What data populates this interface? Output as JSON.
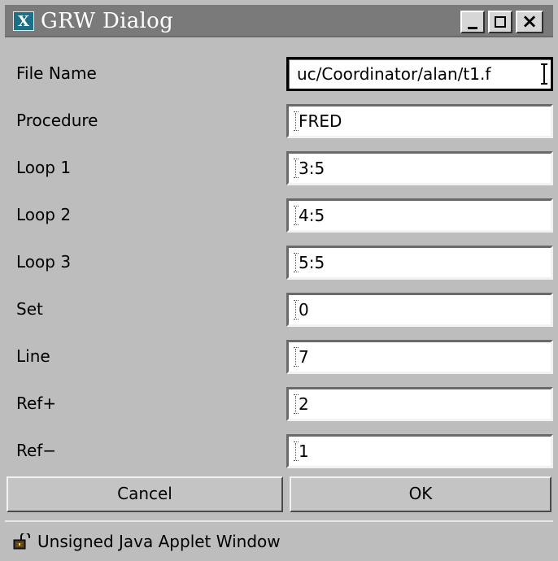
{
  "window": {
    "title": "GRW Dialog",
    "app_icon_letter": "X"
  },
  "fields": [
    {
      "label": "File Name",
      "value": "uc/Coordinator/alan/t1.f"
    },
    {
      "label": "Procedure",
      "value": "FRED"
    },
    {
      "label": "Loop 1",
      "value": "3:5"
    },
    {
      "label": "Loop 2",
      "value": "4:5"
    },
    {
      "label": "Loop 3",
      "value": "5:5"
    },
    {
      "label": "Set",
      "value": "0"
    },
    {
      "label": "Line",
      "value": "7"
    },
    {
      "label": "Ref+",
      "value": "2"
    },
    {
      "label": "Ref−",
      "value": "1"
    }
  ],
  "buttons": {
    "cancel": "Cancel",
    "ok": "OK"
  },
  "status": {
    "text": "Unsigned Java Applet Window",
    "icon": "unlocked-padlock-icon"
  },
  "colors": {
    "background": "#bdbdbd",
    "titlebar": "#7a7a7a",
    "app_icon": "#1d6f86",
    "field_bg": "#ffffff"
  }
}
